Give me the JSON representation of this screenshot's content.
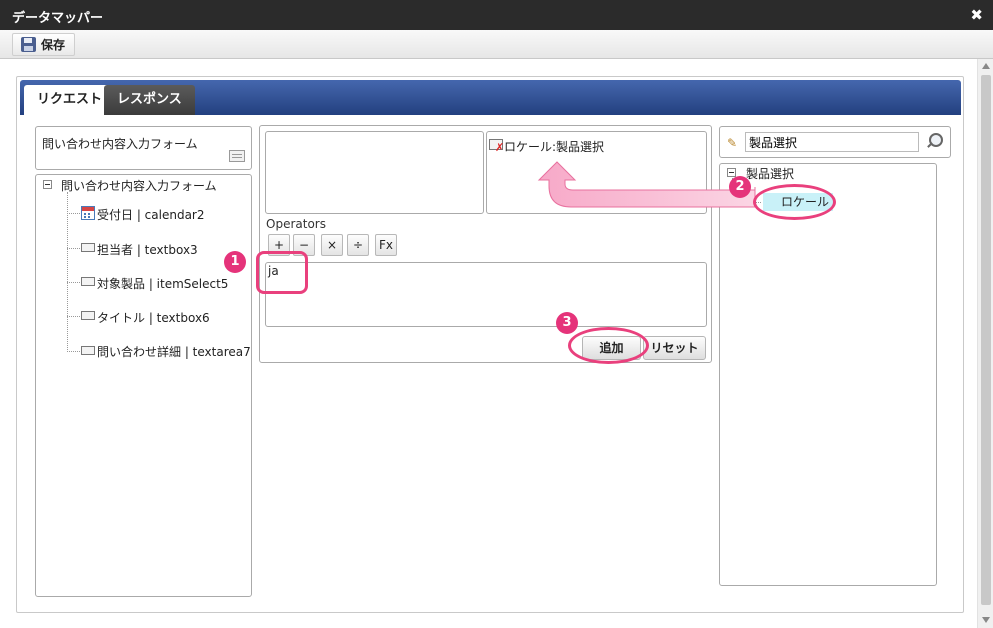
{
  "window": {
    "title": "データマッパー"
  },
  "toolbar": {
    "save_label": "保存"
  },
  "tabs": [
    {
      "label": "リクエスト",
      "active": true
    },
    {
      "label": "レスポンス",
      "active": false
    }
  ],
  "left": {
    "form_name": "問い合わせ内容入力フォーム",
    "tree_root": "問い合わせ内容入力フォーム",
    "items": [
      {
        "label": "受付日 | calendar2",
        "icon": "calendar-icon"
      },
      {
        "label": "担当者 | textbox3",
        "icon": "field-icon"
      },
      {
        "label": "対象製品 | itemSelect5",
        "icon": "field-icon"
      },
      {
        "label": "タイトル | textbox6",
        "icon": "field-icon"
      },
      {
        "label": "問い合わせ詳細 | textarea7",
        "icon": "field-icon"
      }
    ]
  },
  "middle": {
    "mapped_target": "ロケール:製品選択",
    "operators_label": "Operators",
    "operators": [
      "+",
      "−",
      "×",
      "÷",
      "Fx"
    ],
    "expression_value": "ja",
    "add_label": "追加",
    "reset_label": "リセット"
  },
  "right": {
    "search_value": "製品選択",
    "tree_root": "製品選択",
    "tree_child": "ロケール"
  },
  "callouts": [
    "1",
    "2",
    "3"
  ],
  "colors": {
    "accent": "#e5337a",
    "tab_bar": "#2f4d91",
    "highlight": "#c9f1f8"
  }
}
